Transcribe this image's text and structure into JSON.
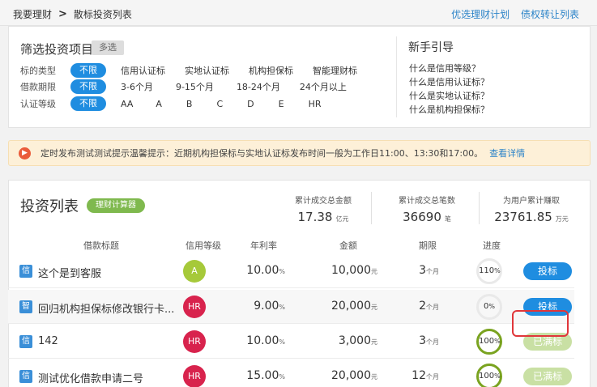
{
  "breadcrumb": {
    "root": "我要理财",
    "separator": ">",
    "current": "散标投资列表"
  },
  "top_links": [
    "优选理财计划",
    "债权转让列表"
  ],
  "filter": {
    "title": "筛选投资项目",
    "multi_label": "多选",
    "rows": [
      {
        "label": "标的类型",
        "selected": "不限",
        "options": [
          "信用认证标",
          "实地认证标",
          "机构担保标",
          "智能理财标"
        ]
      },
      {
        "label": "借款期限",
        "selected": "不限",
        "options": [
          "3-6个月",
          "9-15个月",
          "18-24个月",
          "24个月以上"
        ]
      },
      {
        "label": "认证等级",
        "selected": "不限",
        "options": [
          "AA",
          "A",
          "B",
          "C",
          "D",
          "E",
          "HR"
        ]
      }
    ]
  },
  "guide": {
    "title": "新手引导",
    "links": [
      "什么是信用等级？",
      "什么是信用认证标？",
      "什么是实地认证标？",
      "什么是机构担保标？"
    ]
  },
  "notice": {
    "icon": "speaker-icon",
    "text": "定时发布测试测试提示温馨提示：近期机构担保标与实地认证标发布时间一般为工作日11:00、13:30和17:00。",
    "link": "查看详情"
  },
  "list": {
    "title": "投资列表",
    "calc_label": "理财计算器",
    "stats": [
      {
        "label": "累计成交总金额",
        "value": "17.38",
        "unit": "亿元"
      },
      {
        "label": "累计成交总笔数",
        "value": "36690",
        "unit": "笔"
      },
      {
        "label": "为用户累计赚取",
        "value": "23761.85",
        "unit": "万元"
      }
    ],
    "headers": [
      "借款标题",
      "信用等级",
      "年利率",
      "金额",
      "期限",
      "进度"
    ],
    "rows": [
      {
        "tag": "信",
        "title": "这个是到客服",
        "grade": "A",
        "grade_color": "#a6c93a",
        "rate": "10.00",
        "rate_unit": "%",
        "amount": "10,000",
        "amount_unit": "元",
        "term": "3",
        "term_unit": "个月",
        "progress": "110",
        "progress_unit": "%",
        "action": "投标",
        "action_state": "open"
      },
      {
        "tag": "智",
        "title": "回归机构担保标修改银行卡...",
        "grade": "HR",
        "grade_color": "#d8234d",
        "rate": "9.00",
        "rate_unit": "%",
        "amount": "20,000",
        "amount_unit": "元",
        "term": "2",
        "term_unit": "个月",
        "progress": "0",
        "progress_unit": "%",
        "action": "投标",
        "action_state": "open"
      },
      {
        "tag": "信",
        "title": "142",
        "grade": "HR",
        "grade_color": "#d8234d",
        "rate": "10.00",
        "rate_unit": "%",
        "amount": "3,000",
        "amount_unit": "元",
        "term": "3",
        "term_unit": "个月",
        "progress": "100",
        "progress_unit": "%",
        "action": "已满标",
        "action_state": "full"
      },
      {
        "tag": "信",
        "title": "测试优化借款申请二号",
        "grade": "HR",
        "grade_color": "#d8234d",
        "rate": "15.00",
        "rate_unit": "%",
        "amount": "20,000",
        "amount_unit": "元",
        "term": "12",
        "term_unit": "个月",
        "progress": "100",
        "progress_unit": "%",
        "action": "已满标",
        "action_state": "full"
      }
    ]
  }
}
